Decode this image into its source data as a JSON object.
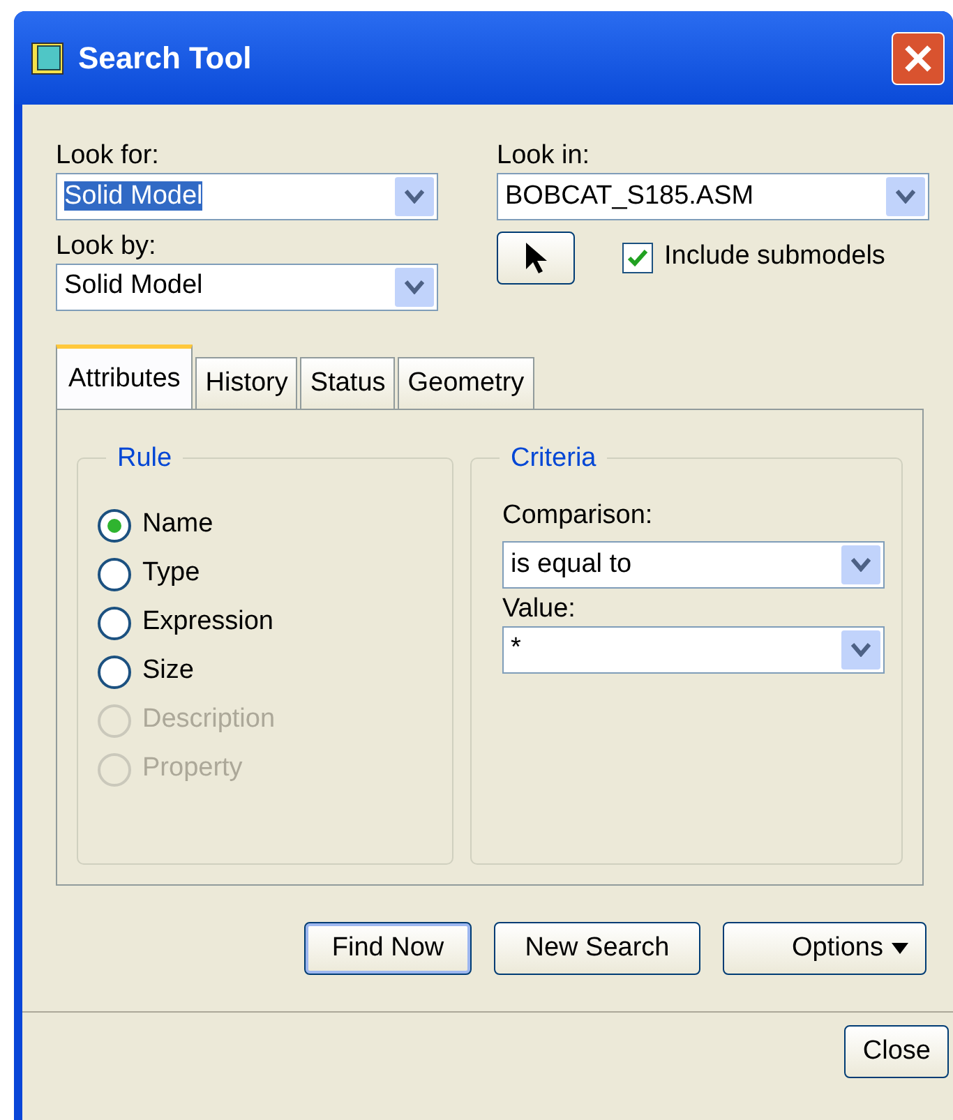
{
  "window": {
    "title": "Search Tool"
  },
  "look_for": {
    "label": "Look for:",
    "value": "Solid Model",
    "text_selected": true
  },
  "look_in": {
    "label": "Look in:",
    "value": "BOBCAT_S185.ASM"
  },
  "look_by": {
    "label": "Look by:",
    "value": "Solid Model",
    "text_selected": false
  },
  "include_submodels": {
    "label": "Include submodels",
    "checked": true
  },
  "tabs": [
    {
      "label": "Attributes",
      "selected": true
    },
    {
      "label": "History",
      "selected": false
    },
    {
      "label": "Status",
      "selected": false
    },
    {
      "label": "Geometry",
      "selected": false
    }
  ],
  "rule": {
    "title": "Rule",
    "options": [
      {
        "label": "Name",
        "selected": true,
        "disabled": false
      },
      {
        "label": "Type",
        "selected": false,
        "disabled": false
      },
      {
        "label": "Expression",
        "selected": false,
        "disabled": false
      },
      {
        "label": "Size",
        "selected": false,
        "disabled": false
      },
      {
        "label": "Description",
        "selected": false,
        "disabled": true
      },
      {
        "label": "Property",
        "selected": false,
        "disabled": true
      }
    ]
  },
  "criteria": {
    "title": "Criteria",
    "comparison": {
      "label": "Comparison:",
      "value": "is equal to"
    },
    "value": {
      "label": "Value:",
      "value": "*"
    }
  },
  "buttons": [
    {
      "label": "Find Now",
      "kind": "default"
    },
    {
      "label": "New Search",
      "kind": "plain"
    },
    {
      "label": "Options",
      "kind": "menu"
    }
  ],
  "close_button": {
    "label": "Close"
  }
}
